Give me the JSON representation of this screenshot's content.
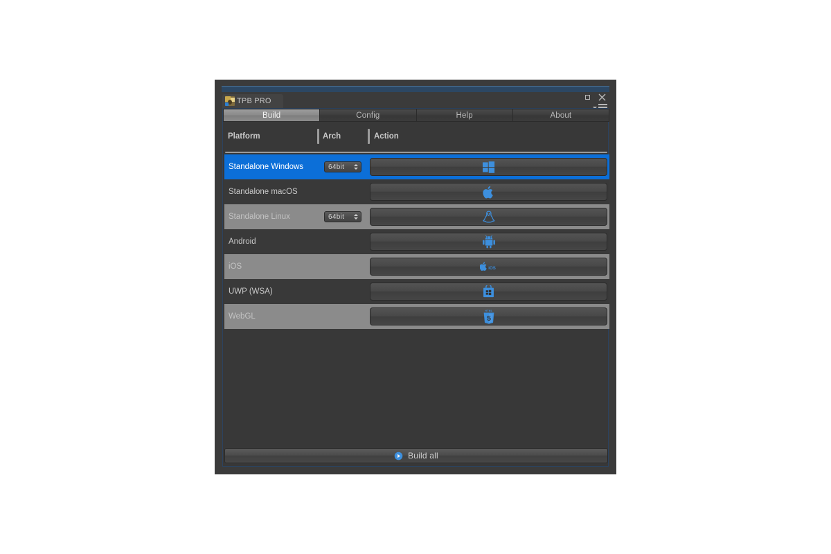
{
  "window": {
    "tab_title": "TPB PRO",
    "tab_icon": "tpb-pro-logo-icon",
    "controls": {
      "maximize": "maximize-icon",
      "close": "close-icon",
      "menu": "panel-menu-icon"
    }
  },
  "tabs": [
    {
      "label": "Build",
      "active": true
    },
    {
      "label": "Config",
      "active": false
    },
    {
      "label": "Help",
      "active": false
    },
    {
      "label": "About",
      "active": false
    }
  ],
  "columns": {
    "platform": "Platform",
    "arch": "Arch",
    "action": "Action"
  },
  "rows": [
    {
      "platform": "Standalone Windows",
      "arch": "64bit",
      "has_arch": true,
      "icon": "windows-icon",
      "selected": true,
      "stripe": "odd"
    },
    {
      "platform": "Standalone macOS",
      "arch": "",
      "has_arch": false,
      "icon": "apple-icon",
      "selected": false,
      "stripe": "odd"
    },
    {
      "platform": "Standalone Linux",
      "arch": "64bit",
      "has_arch": true,
      "icon": "linux-penguin-icon",
      "selected": false,
      "stripe": "even"
    },
    {
      "platform": "Android",
      "arch": "",
      "has_arch": false,
      "icon": "android-icon",
      "selected": false,
      "stripe": "odd"
    },
    {
      "platform": "iOS",
      "arch": "",
      "has_arch": false,
      "icon": "ios-apple-icon",
      "selected": false,
      "stripe": "even"
    },
    {
      "platform": "UWP (WSA)",
      "arch": "",
      "has_arch": false,
      "icon": "windows-store-icon",
      "selected": false,
      "stripe": "odd"
    },
    {
      "platform": "WebGL",
      "arch": "",
      "has_arch": false,
      "icon": "html5-icon",
      "selected": false,
      "stripe": "even"
    }
  ],
  "footer": {
    "build_all_label": "Build all",
    "build_all_icon": "play-circle-icon"
  },
  "colors": {
    "accent_blue": "#0c6fd8",
    "icon_blue": "#3d8fdd",
    "panel_bg": "#383838",
    "row_dark": "#393939",
    "row_light": "#8b8b8b",
    "window_frame": "#3b3b3b"
  }
}
